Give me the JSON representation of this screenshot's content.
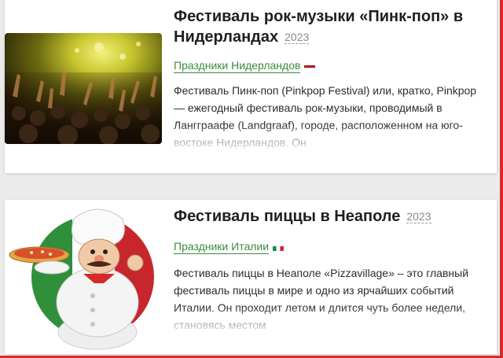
{
  "cards": [
    {
      "title": "Фестиваль рок-музыки «Пинк-поп» в Нидерландах",
      "year": "2023",
      "category": "Праздники Нидерландов",
      "flag_colors": [
        "#ae1c28",
        "#ffffff",
        "#21468b"
      ],
      "description": "Фестиваль Пинк-поп (Pinkpop Festival) или, кратко, Pinkpop — ежегодный фестиваль рок-музыки, проводимый в Лангграафе (Landgraaf), городе, расположенном на юго-востоке Нидерландов. Он"
    },
    {
      "title": "Фестиваль пиццы в Неаполе",
      "year": "2023",
      "category": "Праздники Италии",
      "flag_colors": [
        "#009246",
        "#ffffff",
        "#ce2b37"
      ],
      "description": "Фестиваль пиццы в Неаполе «Pizzavillage» – это главный фестиваль пиццы в мире и одно из ярчайших событий Италии. Он проходит летом и длится чуть более недели, становясь местом"
    }
  ],
  "colors": {
    "link_green": "#3d8a3d",
    "accent_red": "#d92a2a"
  }
}
